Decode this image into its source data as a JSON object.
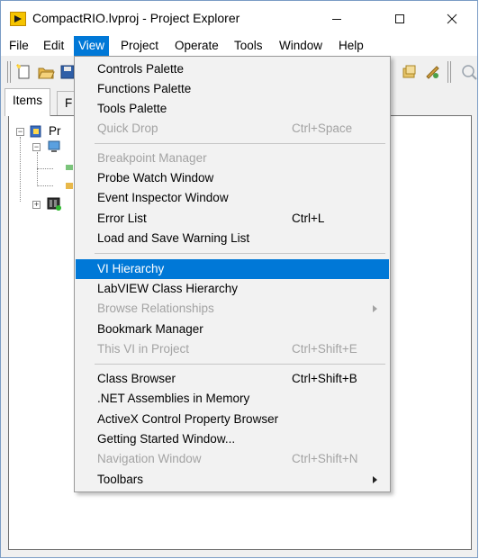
{
  "window": {
    "title": "CompactRIO.lvproj - Project Explorer",
    "buttons": {
      "minimize": "—",
      "maximize": "☐",
      "close": "✕"
    }
  },
  "menubar": [
    {
      "label": "File"
    },
    {
      "label": "Edit"
    },
    {
      "label": "View",
      "active": true
    },
    {
      "label": "Project"
    },
    {
      "label": "Operate"
    },
    {
      "label": "Tools"
    },
    {
      "label": "Window"
    },
    {
      "label": "Help"
    }
  ],
  "toolbar": {
    "icons": [
      "new-file-icon",
      "open-folder-icon",
      "save-icon",
      "deploy-icon",
      "build-icon",
      "help-icon"
    ]
  },
  "tabs": [
    {
      "label": "Items",
      "selected": true
    },
    {
      "label": "F",
      "selected": false
    }
  ],
  "tree": {
    "root_label": "Pr",
    "nodes": [
      "project-root",
      "my-computer",
      "target-item-1",
      "target-item-2",
      "compactrio-target"
    ]
  },
  "view_menu": {
    "items": [
      {
        "label": "Controls Palette",
        "shortcut": "",
        "disabled": false
      },
      {
        "label": "Functions Palette",
        "shortcut": "",
        "disabled": false
      },
      {
        "label": "Tools Palette",
        "shortcut": "",
        "disabled": false
      },
      {
        "label": "Quick Drop",
        "shortcut": "Ctrl+Space",
        "disabled": true
      },
      {
        "label": "Breakpoint Manager",
        "shortcut": "",
        "disabled": true
      },
      {
        "label": "Probe Watch Window",
        "shortcut": "",
        "disabled": false
      },
      {
        "label": "Event Inspector Window",
        "shortcut": "",
        "disabled": false
      },
      {
        "label": "Error List",
        "shortcut": "Ctrl+L",
        "disabled": false
      },
      {
        "label": "Load and Save Warning List",
        "shortcut": "",
        "disabled": false
      },
      {
        "label": "VI Hierarchy",
        "shortcut": "",
        "disabled": false,
        "highlighted": true
      },
      {
        "label": "LabVIEW Class Hierarchy",
        "shortcut": "",
        "disabled": false
      },
      {
        "label": "Browse Relationships",
        "shortcut": "",
        "disabled": true,
        "submenu": true
      },
      {
        "label": "Bookmark Manager",
        "shortcut": "",
        "disabled": false
      },
      {
        "label": "This VI in Project",
        "shortcut": "Ctrl+Shift+E",
        "disabled": true
      },
      {
        "label": "Class Browser",
        "shortcut": "Ctrl+Shift+B",
        "disabled": false
      },
      {
        "label": ".NET Assemblies in Memory",
        "shortcut": "",
        "disabled": false
      },
      {
        "label": "ActiveX Control Property Browser",
        "shortcut": "",
        "disabled": false
      },
      {
        "label": "Getting Started Window...",
        "shortcut": "",
        "disabled": false
      },
      {
        "label": "Navigation Window",
        "shortcut": "Ctrl+Shift+N",
        "disabled": true
      },
      {
        "label": "Toolbars",
        "shortcut": "",
        "disabled": false,
        "submenu": true
      }
    ]
  },
  "colors": {
    "highlight": "#0078d7",
    "disabled_text": "#a3a3a3",
    "menu_background": "#f2f2f2",
    "app_icon": "#f5c400"
  }
}
